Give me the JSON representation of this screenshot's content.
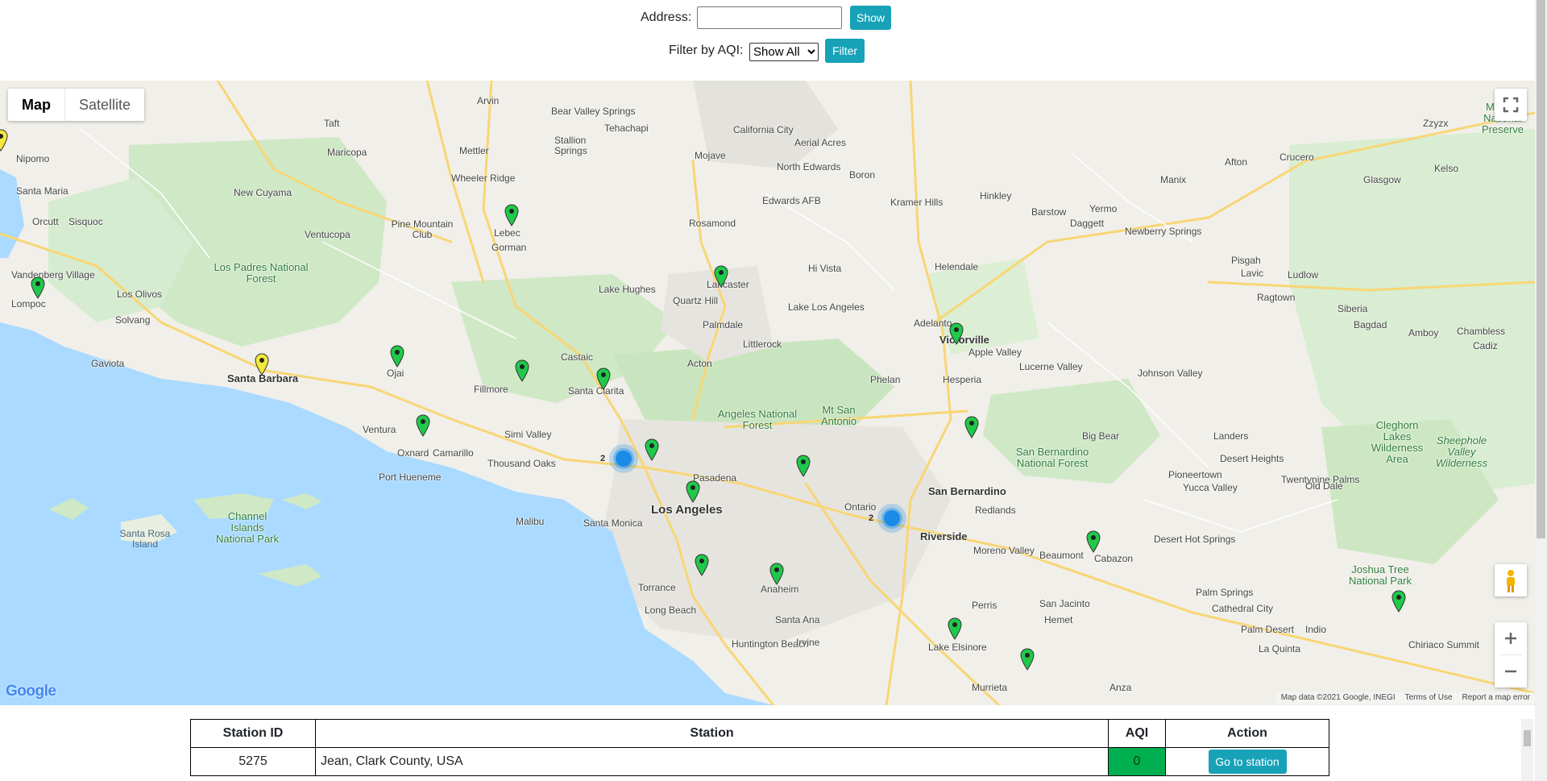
{
  "address": {
    "label": "Address:",
    "value": "",
    "show_label": "Show"
  },
  "filter": {
    "label": "Filter by AQI:",
    "selected": "Show All",
    "button_label": "Filter"
  },
  "map": {
    "type_buttons": [
      "Map",
      "Satellite"
    ],
    "logo": "Google",
    "attribution": [
      "Map data ©2021 Google, INEGI",
      "Terms of Use",
      "Report a map error"
    ],
    "cluster_counts": [
      "2",
      "2"
    ],
    "places": [
      "Nipomo",
      "Santa Maria",
      "Orcutt",
      "Sisquoc",
      "Vandenberg Village",
      "Lompoc",
      "Los Olivos",
      "Solvang",
      "Gaviota",
      "Santa Barbara",
      "Ojai",
      "Ventura",
      "Oxnard",
      "Camarillo",
      "Port Hueneme",
      "Fillmore",
      "Simi Valley",
      "Thousand Oaks",
      "Malibu",
      "Santa Monica",
      "Los Angeles",
      "Pasadena",
      "Torrance",
      "Long Beach",
      "Anaheim",
      "Santa Ana",
      "Huntington Beach",
      "Irvine",
      "Castaic",
      "Santa Clarita",
      "Acton",
      "Lake Hughes",
      "Quartz Hill",
      "Lancaster",
      "Palmdale",
      "Littlerock",
      "Lake Los Angeles",
      "Rosamond",
      "Edwards AFB",
      "Mojave",
      "California City",
      "North Edwards",
      "Boron",
      "Kramer Hills",
      "Hinkley",
      "Barstow",
      "Yermo",
      "Daggett",
      "Newberry Springs",
      "Helendale",
      "Adelanto",
      "Victorville",
      "Apple Valley",
      "Hesperia",
      "Phelan",
      "Lucerne Valley",
      "Johnson Valley",
      "Big Bear",
      "Landers",
      "San Bernardino",
      "Redlands",
      "Ontario",
      "Riverside",
      "Moreno Valley",
      "Perris",
      "Lake Elsinore",
      "Murrieta",
      "Hemet",
      "San Jacinto",
      "Beaumont",
      "Cabazon",
      "Desert Hot Springs",
      "Palm Springs",
      "Cathedral City",
      "Palm Desert",
      "Indio",
      "La Quinta",
      "Yucca Valley",
      "Twentynine Palms",
      "Desert Heights",
      "Pioneertown",
      "Joshua Tree National Park",
      "Chiriaco Summit",
      "Old Dale",
      "Amboy",
      "Bagdad",
      "Ludlow",
      "Pisgah",
      "Lavic",
      "Ragtown",
      "Siberia",
      "Chambless",
      "Cadiz",
      "Manix",
      "Afton",
      "Crucero",
      "Glasgow",
      "Kelso",
      "Zzyzx",
      "Arvin",
      "Taft",
      "Maricopa",
      "Mettler",
      "Wheeler Ridge",
      "Lebec",
      "Gorman",
      "Bear Valley Springs",
      "Tehachapi",
      "Stallion Springs",
      "New Cuyama",
      "Pine Mountain Club",
      "Ventucopa",
      "Anza",
      "Hi Vista",
      "Aerial Acres"
    ],
    "parks": [
      "Los Padres National Forest",
      "Angeles National Forest",
      "San Bernardino National Forest",
      "Channel Islands National Park",
      "Cleghorn Lakes Wilderness Area",
      "Sheephole Valley Wilderness",
      "Mojave National Preserve",
      "Mt San Antonio"
    ],
    "islands": [
      "Santa Rosa Island"
    ]
  },
  "table": {
    "headers": [
      "Station ID",
      "Station",
      "AQI",
      "Action"
    ],
    "rows": [
      {
        "id": "5275",
        "station": "Jean, Clark County, USA",
        "aqi": "0",
        "action": "Go to station"
      }
    ]
  },
  "colors": {
    "accent": "#17a2b8",
    "aqi_good": "#00b050",
    "marker_green": "#1fc94a",
    "marker_yellow": "#f3e93b",
    "cluster": "#1a8ce8"
  }
}
